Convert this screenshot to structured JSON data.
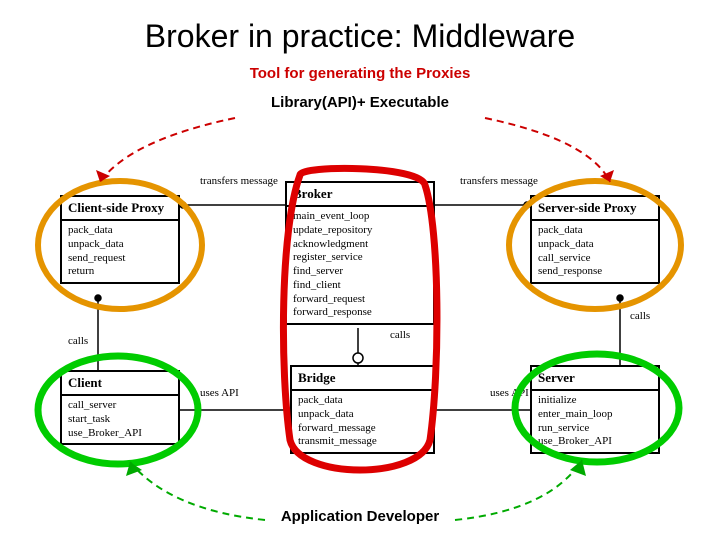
{
  "title": "Broker in practice: Middleware",
  "labels": {
    "top": "Tool for generating the Proxies",
    "sub": "Library(API)+ Executable",
    "bottom": "Application Developer"
  },
  "boxes": {
    "clientProxy": {
      "title": "Client-side Proxy",
      "lines": [
        "pack_data",
        "unpack_data",
        "send_request",
        "return"
      ]
    },
    "broker": {
      "title": "Broker",
      "lines": [
        "main_event_loop",
        "update_repository",
        "acknowledgment",
        "register_service",
        "find_server",
        "find_client",
        "forward_request",
        "forward_response"
      ]
    },
    "serverProxy": {
      "title": "Server-side Proxy",
      "lines": [
        "pack_data",
        "unpack_data",
        "call_service",
        "send_response"
      ]
    },
    "client": {
      "title": "Client",
      "lines": [
        "call_server",
        "start_task",
        "use_Broker_API"
      ]
    },
    "bridge": {
      "title": "Bridge",
      "lines": [
        "pack_data",
        "unpack_data",
        "forward_message",
        "transmit_message"
      ]
    },
    "server": {
      "title": "Server",
      "lines": [
        "initialize",
        "enter_main_loop",
        "run_service",
        "use_Broker_API"
      ]
    }
  },
  "edges": {
    "tl": "transfers message",
    "tr": "transfers message",
    "calls_l": "calls",
    "calls_r": "calls",
    "uses_l": "uses API",
    "uses_r": "uses API",
    "calls_mid": "calls"
  }
}
